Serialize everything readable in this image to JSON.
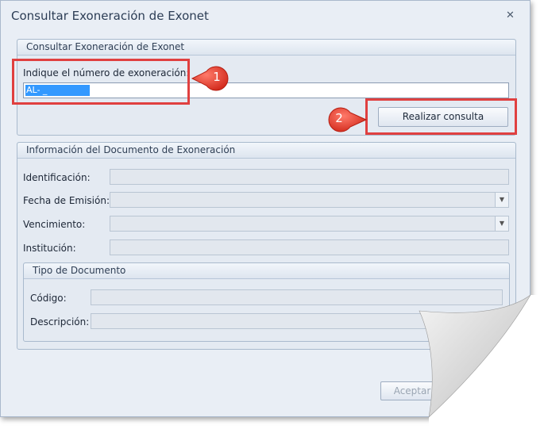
{
  "window": {
    "title": "Consultar Exoneración de Exonet",
    "close_glyph": "✕"
  },
  "query_group": {
    "title": "Consultar Exoneración de Exonet",
    "number_label": "Indique el número de exoneración:",
    "number_value": "AL-           _",
    "submit_label": "Realizar consulta"
  },
  "doc_group": {
    "title": "Información del Documento de Exoneración",
    "id_label": "Identificación:",
    "issue_date_label": "Fecha de Emisión:",
    "expiry_label": "Vencimiento:",
    "institution_label": "Institución:",
    "type_group": {
      "title": "Tipo de Documento",
      "code_label": "Código:",
      "description_label": "Descripción:"
    }
  },
  "footer": {
    "accept_label": "Aceptar"
  },
  "annotations": {
    "step1": "1",
    "step2": "2",
    "highlight_color": "#e04040"
  }
}
